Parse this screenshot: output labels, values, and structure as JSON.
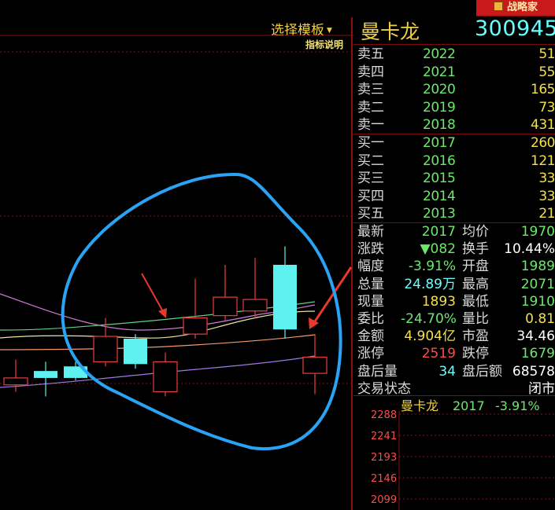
{
  "header": {
    "brand_label": "战略家",
    "template_select": "选择模板",
    "indicator_help": "指标说明",
    "stock_name": "曼卡龙",
    "stock_code": "300945"
  },
  "order_book": {
    "asks": [
      {
        "label": "卖五",
        "price": "2022",
        "vol": "51"
      },
      {
        "label": "卖四",
        "price": "2021",
        "vol": "55"
      },
      {
        "label": "卖三",
        "price": "2020",
        "vol": "165"
      },
      {
        "label": "卖二",
        "price": "2019",
        "vol": "73"
      },
      {
        "label": "卖一",
        "price": "2018",
        "vol": "431"
      }
    ],
    "bids": [
      {
        "label": "买一",
        "price": "2017",
        "vol": "260"
      },
      {
        "label": "买二",
        "price": "2016",
        "vol": "121"
      },
      {
        "label": "买三",
        "price": "2015",
        "vol": "33"
      },
      {
        "label": "买四",
        "price": "2014",
        "vol": "33"
      },
      {
        "label": "买五",
        "price": "2013",
        "vol": "21"
      }
    ]
  },
  "stats": [
    {
      "l1": "最新",
      "v1": "2017",
      "c1": "#6de86d",
      "l2": "均价",
      "v2": "1970",
      "c2": "#6de86d"
    },
    {
      "l1": "涨跌",
      "v1": "▼082",
      "c1": "#6de86d",
      "l2": "换手",
      "v2": "10.44%",
      "c2": "#ffffff"
    },
    {
      "l1": "幅度",
      "v1": "-3.91%",
      "c1": "#6de86d",
      "l2": "开盘",
      "v2": "1989",
      "c2": "#6de86d"
    },
    {
      "l1": "总量",
      "v1": "24.89万",
      "c1": "#66ffff",
      "l2": "最高",
      "v2": "2071",
      "c2": "#6de86d"
    },
    {
      "l1": "现量",
      "v1": "1893",
      "c1": "#f5e04a",
      "l2": "最低",
      "v2": "1910",
      "c2": "#6de86d"
    },
    {
      "l1": "委比",
      "v1": "-24.70%",
      "c1": "#6de86d",
      "l2": "量比",
      "v2": "0.81",
      "c2": "#f5e04a"
    },
    {
      "l1": "金额",
      "v1": "4.904亿",
      "c1": "#f5e04a",
      "l2": "市盈",
      "v2": "34.46",
      "c2": "#ffffff"
    },
    {
      "l1": "涨停",
      "v1": "2519",
      "c1": "#ff4a4a",
      "l2": "跌停",
      "v2": "1679",
      "c2": "#6de86d"
    },
    {
      "l1": "盘后量",
      "v1": "34",
      "c1": "#66ffff",
      "l2": "盘后额",
      "v2": "68578",
      "c2": "#ffffff"
    },
    {
      "l1": "交易状态",
      "v1": "",
      "c1": "#ffffff",
      "l2": "",
      "v2": "闭市",
      "c2": "#ffffff"
    }
  ],
  "mini_chart": {
    "title_name": "曼卡龙",
    "title_price": "2017",
    "title_change": "-3.91%",
    "price_ticks": [
      "2288",
      "2241",
      "2193",
      "2146",
      "2099"
    ]
  },
  "chart_data": {
    "type": "candlestick",
    "candles": [
      {
        "open": 19.7,
        "close": 20.0,
        "high": 20.8,
        "low": 19.4,
        "dir": "up"
      },
      {
        "open": 20.3,
        "close": 20.0,
        "high": 20.7,
        "low": 19.2,
        "dir": "down"
      },
      {
        "open": 20.5,
        "close": 20.0,
        "high": 20.7,
        "low": 19.9,
        "dir": "down"
      },
      {
        "open": 20.7,
        "close": 21.8,
        "high": 22.6,
        "low": 20.5,
        "dir": "up"
      },
      {
        "open": 21.7,
        "close": 20.6,
        "high": 21.9,
        "low": 20.4,
        "dir": "down"
      },
      {
        "open": 20.7,
        "close": 19.4,
        "high": 21.1,
        "low": 19.2,
        "dir": "up"
      },
      {
        "open": 21.9,
        "close": 22.6,
        "high": 24.3,
        "low": 21.7,
        "dir": "up"
      },
      {
        "open": 22.7,
        "close": 23.5,
        "high": 24.9,
        "low": 22.5,
        "dir": "up"
      },
      {
        "open": 22.9,
        "close": 23.4,
        "high": 25.2,
        "low": 22.6,
        "dir": "up"
      },
      {
        "open": 24.9,
        "close": 22.1,
        "high": 25.7,
        "low": 21.7,
        "dir": "down"
      },
      {
        "open": 20.9,
        "close": 20.2,
        "high": 21.9,
        "low": 19.3,
        "dir": "up"
      }
    ],
    "colors": {
      "up": "#e84040",
      "down": "#5ff0f0",
      "annotation": "#2aa3f5",
      "arrow": "#e83a2a"
    }
  }
}
